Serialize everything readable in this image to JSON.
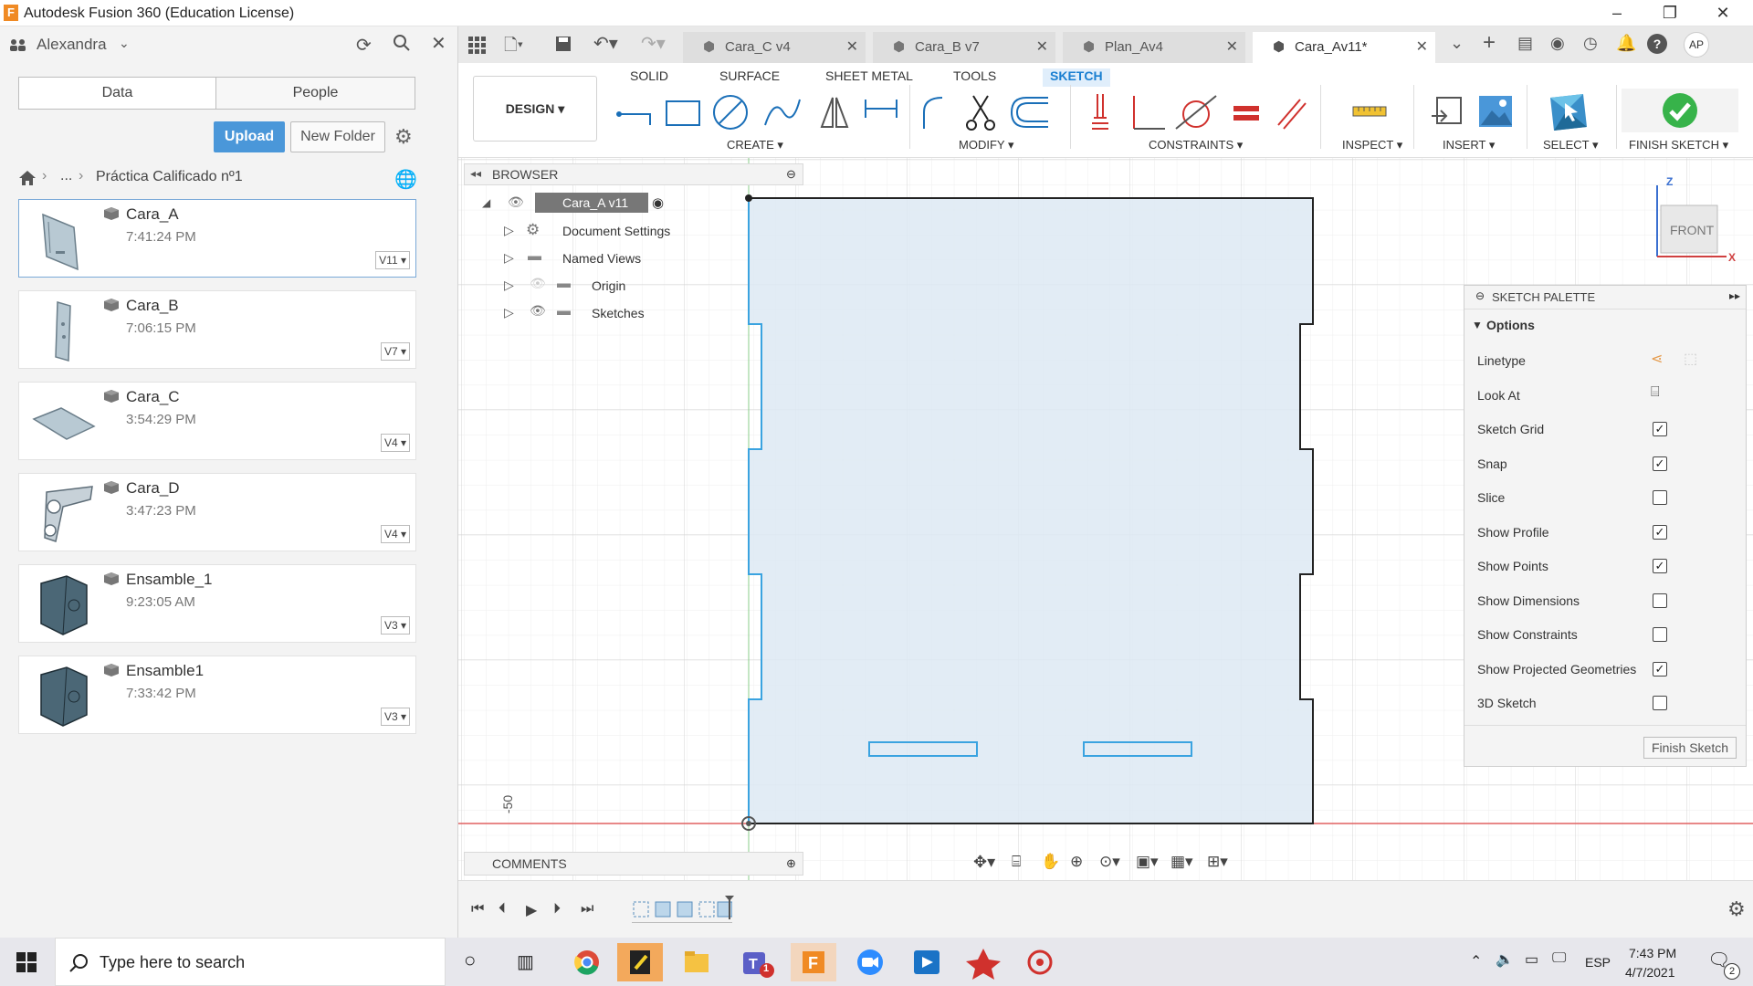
{
  "window": {
    "title": "Autodesk Fusion 360 (Education License)",
    "icon_letter": "F"
  },
  "data_panel": {
    "user": "Alexandra",
    "tabs": [
      {
        "label": "Data"
      },
      {
        "label": "People"
      }
    ],
    "upload_label": "Upload",
    "new_folder_label": "New Folder",
    "breadcrumb": {
      "ellipsis": "...",
      "folder": "Práctica Calificado nº1"
    },
    "files": [
      {
        "name": "Cara_A",
        "time": "7:41:24 PM",
        "version": "V11"
      },
      {
        "name": "Cara_B",
        "time": "7:06:15 PM",
        "version": "V7"
      },
      {
        "name": "Cara_C",
        "time": "3:54:29 PM",
        "version": "V4"
      },
      {
        "name": "Cara_D",
        "time": "3:47:23 PM",
        "version": "V4"
      },
      {
        "name": "Ensamble_1",
        "time": "9:23:05 AM",
        "version": "V3"
      },
      {
        "name": "Ensamble1",
        "time": "7:33:42 PM",
        "version": "V3"
      }
    ]
  },
  "doc_tabs": [
    {
      "label": "Cara_C v4"
    },
    {
      "label": "Cara_B v7"
    },
    {
      "label": "Plan_Av4"
    },
    {
      "label": "Cara_Av11*"
    }
  ],
  "user_initials": "AP",
  "toolbar": {
    "modes": [
      "SOLID",
      "SURFACE",
      "SHEET METAL",
      "TOOLS",
      "SKETCH"
    ],
    "workspace": "DESIGN",
    "groups": {
      "create": "CREATE",
      "modify": "MODIFY",
      "constraints": "CONSTRAINTS",
      "inspect": "INSPECT",
      "insert": "INSERT",
      "select": "SELECT",
      "finish": "FINISH SKETCH"
    }
  },
  "browser": {
    "title": "BROWSER",
    "root": "Cara_A v11",
    "nodes": [
      "Document Settings",
      "Named Views",
      "Origin",
      "Sketches"
    ]
  },
  "viewcube": {
    "face": "FRONT",
    "z": "Z",
    "x": "X"
  },
  "canvas": {
    "axis_label": "-50"
  },
  "palette": {
    "title": "SKETCH PALETTE",
    "section": "Options",
    "options": [
      {
        "label": "Linetype",
        "type": "icons"
      },
      {
        "label": "Look At",
        "type": "icon"
      },
      {
        "label": "Sketch Grid",
        "checked": true
      },
      {
        "label": "Snap",
        "checked": true
      },
      {
        "label": "Slice",
        "checked": false
      },
      {
        "label": "Show Profile",
        "checked": true
      },
      {
        "label": "Show Points",
        "checked": true
      },
      {
        "label": "Show Dimensions",
        "checked": false
      },
      {
        "label": "Show Constraints",
        "checked": false
      },
      {
        "label": "Show Projected Geometries",
        "checked": true
      },
      {
        "label": "3D Sketch",
        "checked": false
      }
    ],
    "finish_label": "Finish Sketch"
  },
  "comments": {
    "title": "COMMENTS"
  },
  "taskbar": {
    "search_placeholder": "Type here to search",
    "time": "7:43 PM",
    "date": "4/7/2021",
    "lang": "ESP",
    "teams_badge": "1",
    "notif_count": "2"
  }
}
